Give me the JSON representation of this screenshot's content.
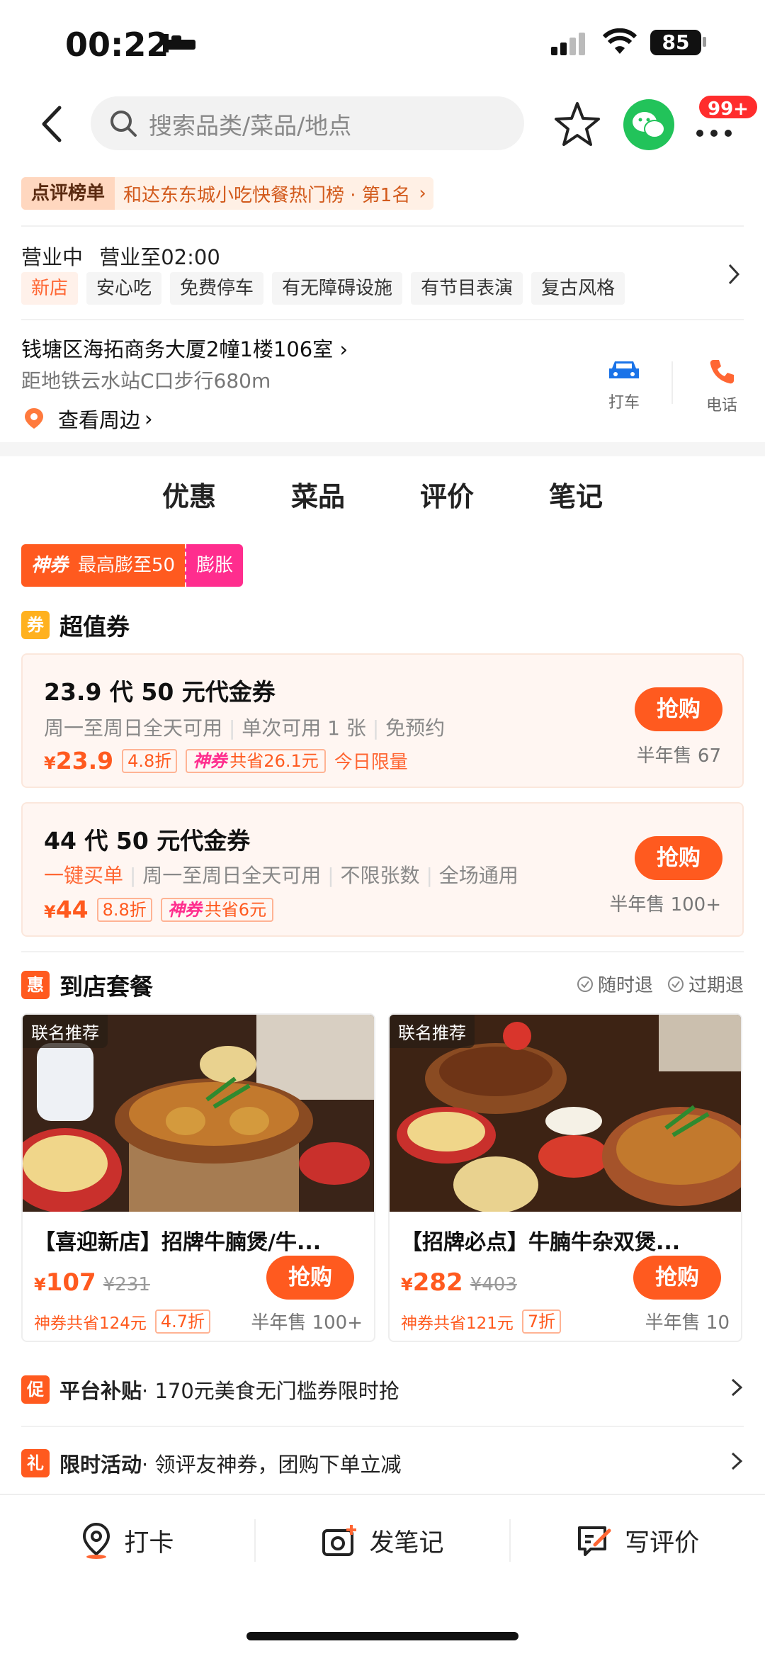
{
  "status": {
    "time": "00:22",
    "battery": "85"
  },
  "nav": {
    "search_placeholder": "搜索品类/菜品/地点",
    "badge": "99+"
  },
  "rank": {
    "tag": "点评榜单",
    "text": "和达东东城小吃快餐热门榜 · 第1名"
  },
  "shop": {
    "open_state": "营业中",
    "hours": "营业至02:00",
    "tags": [
      "新店",
      "安心吃",
      "免费停车",
      "有无障碍设施",
      "有节目表演",
      "复古风格"
    ],
    "address": "钱塘区海拓商务大厦2幢1楼106室",
    "distance": "距地铁云水站C口步行680m",
    "nearby": "查看周边",
    "taxi": "打车",
    "phone": "电话"
  },
  "tabs": [
    "优惠",
    "菜品",
    "评价",
    "笔记"
  ],
  "shen_coupon": {
    "brand": "神券",
    "text": "最高膨至50",
    "action": "膨胀"
  },
  "coupons_section": {
    "icon": "券",
    "title": "超值券"
  },
  "coupons": [
    {
      "title": "23.9 代 50 元代金券",
      "desc": [
        "周一至周日全天可用",
        "单次可用 1 张",
        "免预约"
      ],
      "currency": "¥",
      "price": "23.9",
      "discount": "4.8折",
      "save_brand": "神券",
      "save": "共省26.1元",
      "limit": "今日限量",
      "buy": "抢购",
      "sold": "半年售 67"
    },
    {
      "title": "44 代 50 元代金券",
      "desc_em": "一键买单",
      "desc": [
        "周一至周日全天可用",
        "不限张数",
        "全场通用"
      ],
      "currency": "¥",
      "price": "44",
      "discount": "8.8折",
      "save_brand": "神券",
      "save": "共省6元",
      "buy": "抢购",
      "sold": "半年售 100+"
    }
  ],
  "package_section": {
    "icon": "惠",
    "title": "到店套餐",
    "tag1": "随时退",
    "tag2": "过期退"
  },
  "packages": [
    {
      "label": "联名推荐",
      "title": "【喜迎新店】招牌牛腩煲/牛...",
      "currency": "¥",
      "price": "107",
      "old": "¥231",
      "buy": "抢购",
      "save": "神券共省124元",
      "discount": "4.7折",
      "sold": "半年售 100+"
    },
    {
      "label": "联名推荐",
      "title": "【招牌必点】牛腩牛杂双煲...",
      "currency": "¥",
      "price": "282",
      "old": "¥403",
      "buy": "抢购",
      "save": "神券共省121元",
      "discount": "7折",
      "sold": "半年售 10"
    }
  ],
  "promos": [
    {
      "icon": "促",
      "bold": "平台补贴",
      "text": " · 170元美食无门槛券限时抢"
    },
    {
      "icon": "礼",
      "bold": "限时活动",
      "text": " · 领评友神券，团购下单立减"
    }
  ],
  "bottom": {
    "checkin": "打卡",
    "note": "发笔记",
    "review": "写评价"
  }
}
